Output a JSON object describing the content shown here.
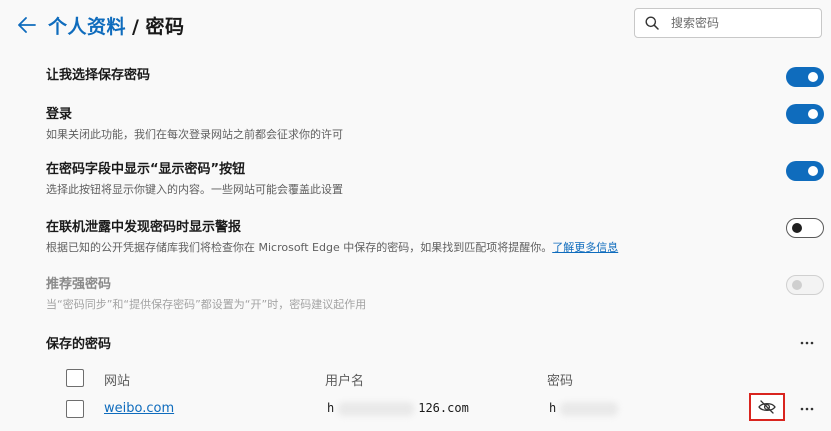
{
  "header": {
    "back_icon": "back-arrow-icon",
    "crumb_profile": "个人资料",
    "crumb_separator": "/",
    "crumb_current": "密码"
  },
  "search": {
    "placeholder": "搜索密码",
    "value": ""
  },
  "settings": [
    {
      "title": "让我选择保存密码",
      "desc": "",
      "toggle": "on"
    },
    {
      "title": "登录",
      "desc": "如果关闭此功能，我们在每次登录网站之前都会征求你的许可",
      "toggle": "on"
    },
    {
      "title": "在密码字段中显示“显示密码”按钮",
      "desc": "选择此按钮将显示你键入的内容。一些网站可能会覆盖此设置",
      "toggle": "on"
    },
    {
      "title": "在联机泄露中发现密码时显示警报",
      "desc": "根据已知的公开凭据存储库我们将检查你在 Microsoft Edge 中保存的密码，如果找到匹配项将提醒你。",
      "learn_more": "了解更多信息",
      "toggle": "off"
    },
    {
      "title": "推荐强密码",
      "desc": "当“密码同步”和“提供保存密码”都设置为“开”时，密码建议起作用",
      "toggle": "disabled"
    }
  ],
  "saved": {
    "title": "保存的密码",
    "columns": {
      "site": "网站",
      "username": "用户名",
      "password": "密码"
    },
    "rows": [
      {
        "site": "weibo.com",
        "username_prefix": "h",
        "username_suffix": "126.com",
        "password_prefix": "h"
      }
    ]
  },
  "colors": {
    "accent": "#0f6cbd",
    "highlight": "#d9251f"
  }
}
